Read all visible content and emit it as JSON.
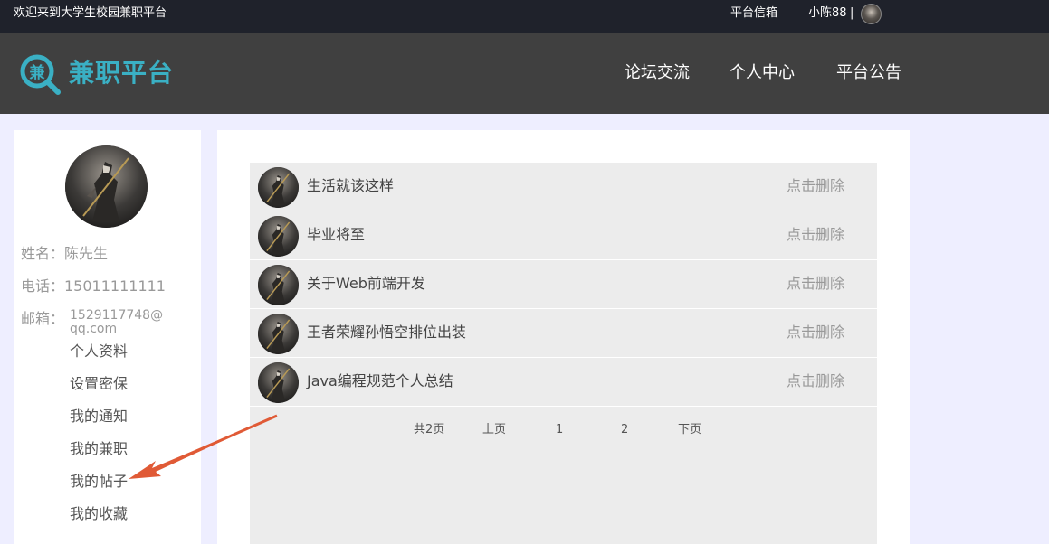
{
  "topbar": {
    "welcome": "欢迎来到大学生校园兼职平台",
    "messages": "平台信箱",
    "username": "小陈88",
    "separator": "|"
  },
  "header": {
    "logo_char": "兼",
    "logo_text": "兼职平台",
    "nav": [
      "论坛交流",
      "个人中心",
      "平台公告"
    ]
  },
  "sidebar": {
    "name": "姓名：陈先生",
    "phone": "电话：15011111111",
    "email_label": "邮箱：",
    "email_value": "1529117748@qq.com",
    "menu": [
      "个人资料",
      "设置密保",
      "我的通知",
      "我的兼职",
      "我的帖子",
      "我的收藏"
    ]
  },
  "posts": [
    {
      "title": "生活就该这样",
      "action": "点击删除"
    },
    {
      "title": "毕业将至",
      "action": "点击删除"
    },
    {
      "title": "关于Web前端开发",
      "action": "点击删除"
    },
    {
      "title": "王者荣耀孙悟空排位出装",
      "action": "点击删除"
    },
    {
      "title": "Java编程规范个人总结",
      "action": "点击删除"
    }
  ],
  "pager": {
    "total": "共2页",
    "prev": "上页",
    "page1": "1",
    "page2": "2",
    "next": "下页"
  },
  "colors": {
    "accent": "#3ab0c4",
    "arrow": "#e05a36",
    "topbar": "#1f222b",
    "header": "#404040"
  }
}
